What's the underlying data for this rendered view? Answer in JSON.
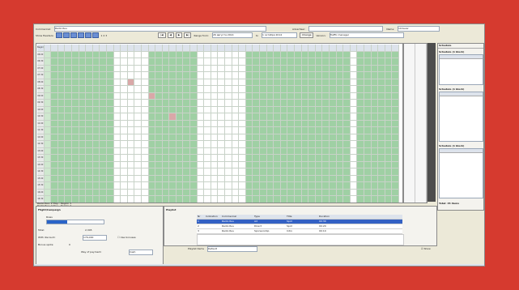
{
  "toolbar": {
    "commercial_label": "Commercial:",
    "commercial_value": "Radio Rus",
    "advertiser_label": "Advertiser:",
    "name_label": "Name:",
    "name_value": "Unilever",
    "show_labels_label": "Show Headers:",
    "page_numbers": "1 2 3",
    "range_label": "Range from:",
    "range_from": "26 августа 2014",
    "range_to_label": "to",
    "range_to": "1 октября 2014",
    "change_button": "Change",
    "version_label": "Version:",
    "version_value": "Traffic manager"
  },
  "months": [
    "August 2014",
    "September 2014",
    "October 2014"
  ],
  "time_column": {
    "header": "Begin/End",
    "times": [
      "06:00",
      "06:30",
      "07:00",
      "07:30",
      "08:00",
      "08:30",
      "09:00",
      "09:30",
      "10:00",
      "10:30",
      "11:00",
      "11:30",
      "12:00",
      "12:30",
      "13:00",
      "13:30",
      "14:00",
      "14:30",
      "15:00",
      "15:30",
      "16:00",
      "16:30",
      "17:00",
      "17:30",
      "18:00",
      "18:30",
      "19:00",
      "19:30",
      "20:00"
    ]
  },
  "legend_rows": [
    "Radio Rus: 2 Day... Region 1",
    "Radio Rus: 2 Day... Region 2"
  ],
  "right_panel": {
    "title": "Schedule",
    "blocks": [
      "Schedule (1 block)",
      "Schedule (1 block)",
      "Schedule (1 block)"
    ],
    "totals": "Total: 45 items"
  },
  "bottom_left": {
    "title": "Flight/Campaign",
    "subtitle": "Rows",
    "progress": 0.35,
    "total_label": "Total:",
    "total_value": "2,345",
    "discount_label": "With discount:",
    "discount_value": "176,000",
    "spots_label": "Bonus spots:",
    "spots_value": "0",
    "way_label": "Way of payment:",
    "way_value": "Cash",
    "checkbox_label": "Use bonuses"
  },
  "playlist": {
    "title": "Playlist",
    "columns": [
      "Nr",
      "Indication",
      "Commercial",
      "Type",
      "Title",
      "Duration"
    ],
    "rows": [
      [
        "1",
        "",
        "Radio Rus",
        "Ad",
        "Spot",
        "00:30"
      ],
      [
        "2",
        "",
        "Radio Rus",
        "Direct",
        "Spot",
        "00:20"
      ],
      [
        "3",
        "",
        "Radio Rus",
        "Sponsorship",
        "Intro",
        "00:10"
      ]
    ],
    "status_label": "Playlist items",
    "status_value": "Default",
    "checkbox_label": "Show"
  },
  "colors": {
    "background": "#d63a2f",
    "green": "#9fd0a4",
    "light_green": "#cfe8cf",
    "selection": "#3361c4"
  }
}
